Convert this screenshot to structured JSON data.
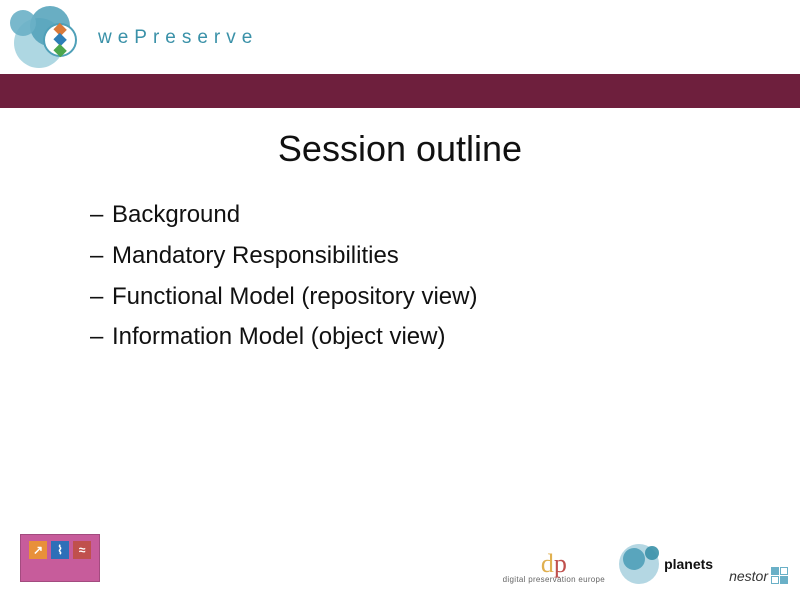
{
  "header": {
    "brand": "wePreserve"
  },
  "title": "Session outline",
  "bullets": [
    "Background",
    "Mandatory Responsibilities",
    "Functional Model (repository view)",
    "Information Model (object view)"
  ],
  "footer": {
    "dp_sub": "digital preservation europe",
    "planets": "planets",
    "nestor": "nestor"
  }
}
